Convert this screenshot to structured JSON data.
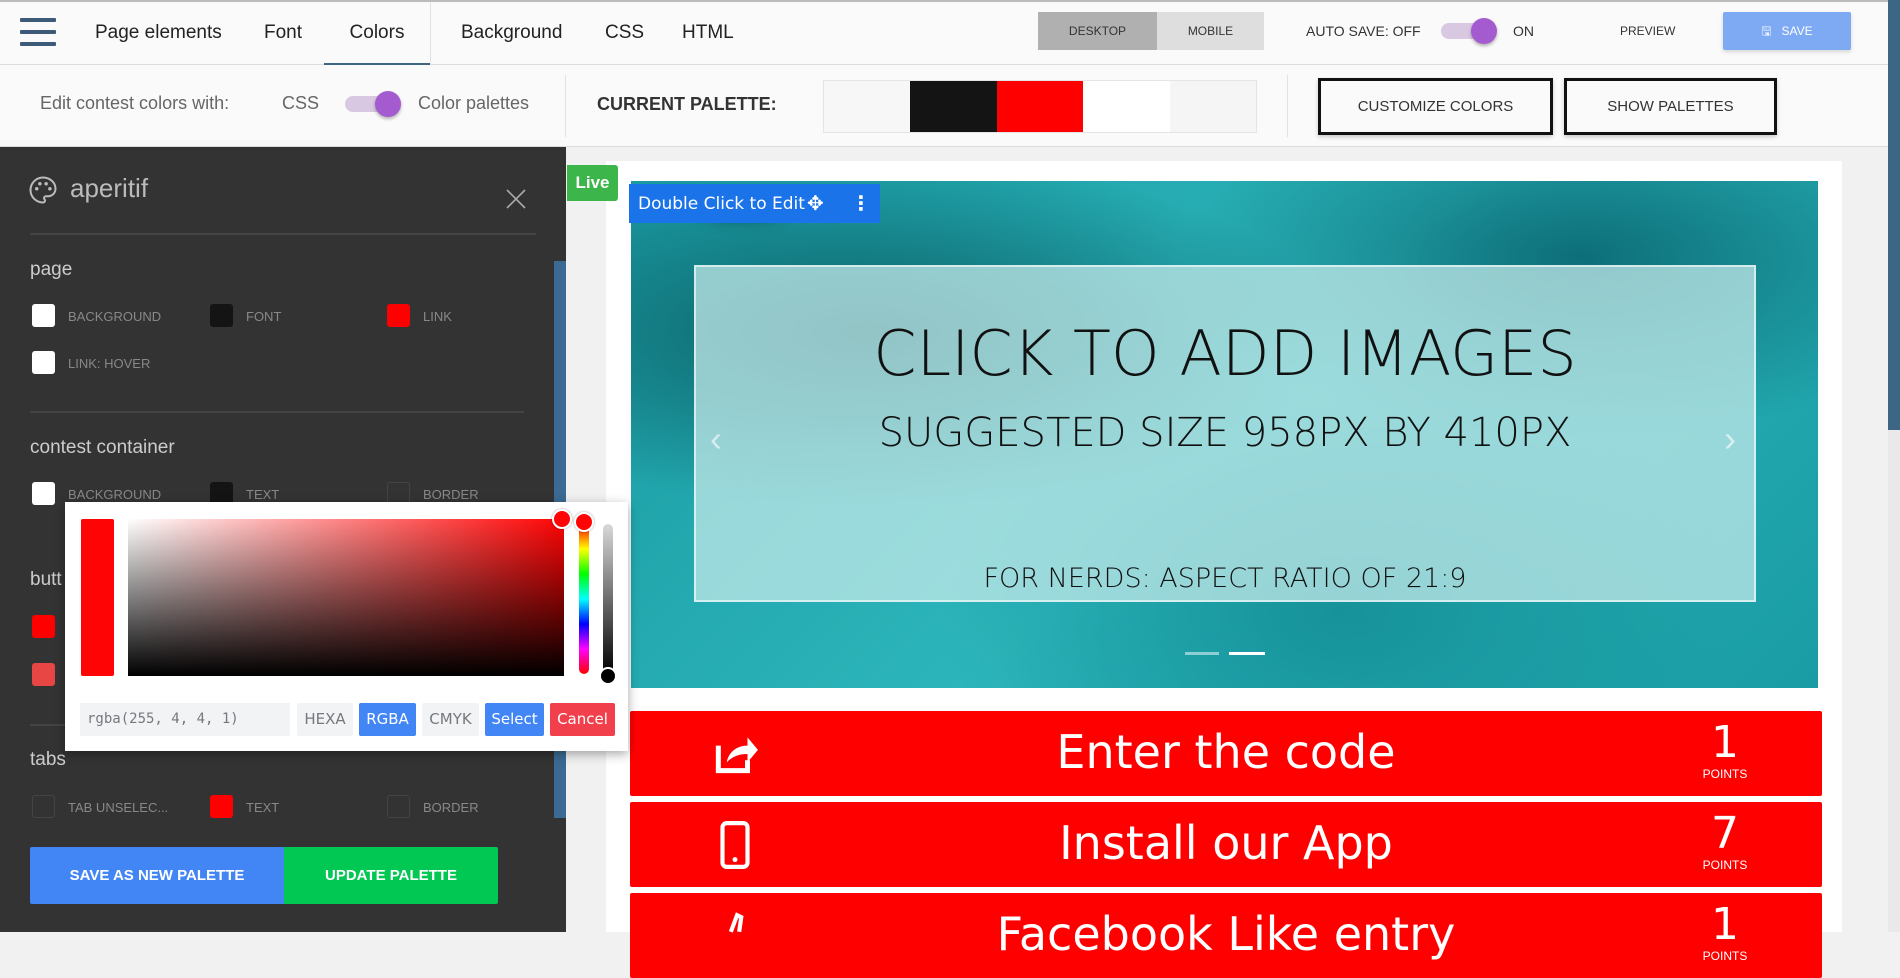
{
  "topbar": {
    "tabs": [
      "Page elements",
      "Font",
      "Colors",
      "Background",
      "CSS",
      "HTML"
    ],
    "active_tab": "Colors",
    "view": {
      "desktop": "DESKTOP",
      "mobile": "MOBILE",
      "selected": "DESKTOP"
    },
    "autosave": {
      "off_label": "AUTO SAVE: OFF",
      "on_label": "ON",
      "enabled": true
    },
    "preview": "PREVIEW",
    "save": "SAVE"
  },
  "subbar": {
    "edit_with": "Edit contest colors with:",
    "css": "CSS",
    "palettes": "Color palettes",
    "mode": "Color palettes",
    "current_palette": "CURRENT PALETTE:",
    "palette_colors": [
      "#f7f7f7",
      "#141414",
      "#ff0000",
      "#ffffff",
      "#f5f5f5"
    ],
    "customize": "CUSTOMIZE COLORS",
    "show_palettes": "SHOW PALETTES"
  },
  "panel": {
    "title": "aperitif",
    "page": {
      "title": "page",
      "items": [
        {
          "label": "BACKGROUND",
          "color": "#ffffff"
        },
        {
          "label": "FONT",
          "color": "#141414"
        },
        {
          "label": "LINK",
          "color": "#ff0000"
        },
        {
          "label": "LINK: HOVER",
          "color": "#ffffff"
        }
      ]
    },
    "container": {
      "title": "contest container",
      "items": [
        {
          "label": "BACKGROUND",
          "color": "#ffffff"
        },
        {
          "label": "TEXT",
          "color": "#141414"
        },
        {
          "label": "BORDER",
          "color": "#333333"
        }
      ]
    },
    "buttons": {
      "title": "butt",
      "colors": [
        "#ff0000",
        "#e84545"
      ]
    },
    "tabs": {
      "title": "tabs",
      "items": [
        {
          "label": "TAB UNSELEC...",
          "color": "#333333"
        },
        {
          "label": "TEXT",
          "color": "#ff0000"
        },
        {
          "label": "BORDER",
          "color": "#333333"
        }
      ]
    },
    "save_new": "SAVE AS NEW PALETTE",
    "update": "UPDATE PALETTE"
  },
  "picker": {
    "value": "rgba(255, 4, 4, 1)",
    "modes": [
      "HEXA",
      "RGBA",
      "CMYK"
    ],
    "active_mode": "RGBA",
    "select": "Select",
    "cancel": "Cancel",
    "color": "#ff0404"
  },
  "preview": {
    "live": "Live",
    "edit_hint": "Double Click to Edit",
    "hero": {
      "line1": "CLICK TO ADD IMAGES",
      "line2": "SUGGESTED SIZE 958PX  BY 410PX",
      "line3": "FOR NERDS: ASPECT RATIO OF 21:9"
    },
    "entries": [
      {
        "icon": "share-icon",
        "label": "Enter the code",
        "points": "1",
        "points_label": "POINTS"
      },
      {
        "icon": "mobile-icon",
        "label": "Install our App",
        "points": "7",
        "points_label": "POINTS"
      },
      {
        "icon": "thumbs-up-icon",
        "label": "Facebook Like entry",
        "points": "1",
        "points_label": "POINTS"
      }
    ]
  }
}
